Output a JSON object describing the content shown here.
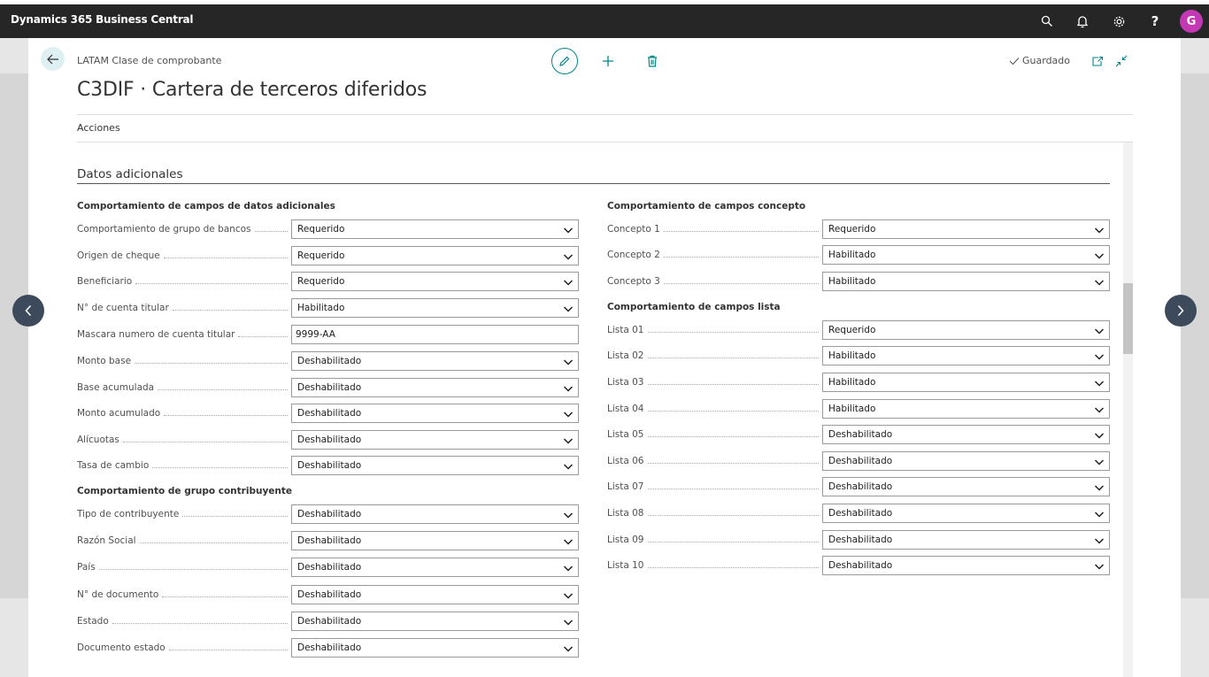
{
  "app": {
    "title": "Dynamics 365 Business Central",
    "avatar_initial": "G"
  },
  "header": {
    "breadcrumb": "LATAM Clase de comprobante",
    "title": "C3DIF · Cartera de terceros diferidos",
    "saved_label": "Guardado",
    "actions_label": "Acciones"
  },
  "section": {
    "title": "Datos adicionales"
  },
  "groups": {
    "datos_adicionales": "Comportamiento de campos de datos adicionales",
    "contribuyente": "Comportamiento de grupo contribuyente",
    "concepto": "Comportamiento de campos concepto",
    "lista": "Comportamiento de campos lista"
  },
  "left_fields": [
    {
      "label": "Comportamiento de grupo de bancos",
      "value": "Requerido"
    },
    {
      "label": "Origen de cheque",
      "value": "Requerido"
    },
    {
      "label": "Beneficiario",
      "value": "Requerido"
    },
    {
      "label": "N° de cuenta titular",
      "value": "Habilitado"
    },
    {
      "label": "Mascara numero de cuenta titular",
      "value": "9999-AA"
    },
    {
      "label": "Monto base",
      "value": "Deshabilitado"
    },
    {
      "label": "Base acumulada",
      "value": "Deshabilitado"
    },
    {
      "label": "Monto acumulado",
      "value": "Deshabilitado"
    },
    {
      "label": "Alícuotas",
      "value": "Deshabilitado"
    },
    {
      "label": "Tasa de cambio",
      "value": "Deshabilitado"
    }
  ],
  "contribuyente_fields": [
    {
      "label": "Tipo de contribuyente",
      "value": "Deshabilitado"
    },
    {
      "label": "Razón Social",
      "value": "Deshabilitado"
    },
    {
      "label": "País",
      "value": "Deshabilitado"
    },
    {
      "label": "N° de documento",
      "value": "Deshabilitado"
    },
    {
      "label": "Estado",
      "value": "Deshabilitado"
    },
    {
      "label": "Documento estado",
      "value": "Deshabilitado"
    }
  ],
  "concepto_fields": [
    {
      "label": "Concepto 1",
      "value": "Requerido"
    },
    {
      "label": "Concepto 2",
      "value": "Habilitado"
    },
    {
      "label": "Concepto 3",
      "value": "Habilitado"
    }
  ],
  "lista_fields": [
    {
      "label": "Lista 01",
      "value": "Requerido"
    },
    {
      "label": "Lista 02",
      "value": "Habilitado"
    },
    {
      "label": "Lista 03",
      "value": "Habilitado"
    },
    {
      "label": "Lista 04",
      "value": "Habilitado"
    },
    {
      "label": "Lista 05",
      "value": "Deshabilitado"
    },
    {
      "label": "Lista 06",
      "value": "Deshabilitado"
    },
    {
      "label": "Lista 07",
      "value": "Deshabilitado"
    },
    {
      "label": "Lista 08",
      "value": "Deshabilitado"
    },
    {
      "label": "Lista 09",
      "value": "Deshabilitado"
    },
    {
      "label": "Lista 10",
      "value": "Deshabilitado"
    }
  ],
  "colors": {
    "appbar": "#262626",
    "accent": "#00858a",
    "avatar": "#c239b3",
    "nav_circle": "#3d4a5b"
  }
}
